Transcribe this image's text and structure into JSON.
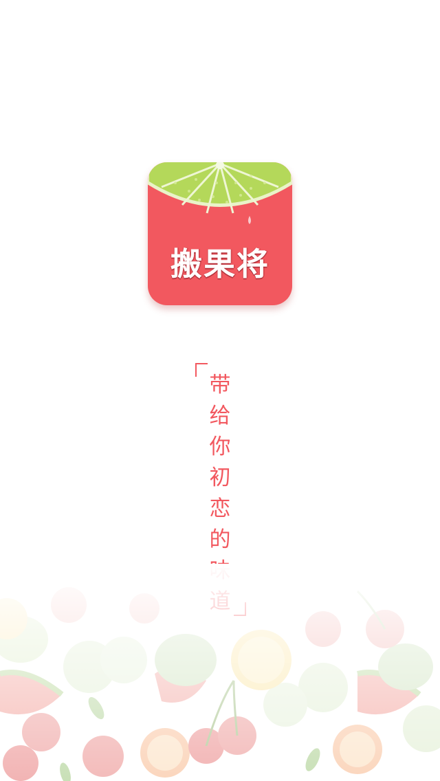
{
  "app": {
    "name": "搬果将"
  },
  "slogan": {
    "characters": [
      "带",
      "给",
      "你",
      "初",
      "恋",
      "的",
      "味",
      "道"
    ]
  },
  "colors": {
    "brand_red": "#f2585f",
    "lime_green": "#b4d85a",
    "background": "#ffffff"
  },
  "icons": {
    "logo": "lime-slice-icon",
    "background": "fruit-pattern"
  }
}
